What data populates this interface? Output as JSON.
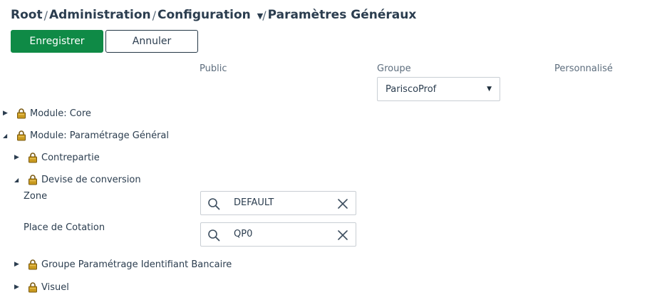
{
  "breadcrumb": {
    "items": [
      "Root",
      "Administration",
      "Configuration"
    ],
    "separator": "/",
    "current": "Paramètres Généraux"
  },
  "toolbar": {
    "save_label": "Enregistrer",
    "cancel_label": "Annuler"
  },
  "columns": {
    "public": "Public",
    "group": "Groupe",
    "custom": "Personnalisé"
  },
  "group_select": {
    "value": "PariscoProf"
  },
  "tree": {
    "module_core": {
      "label": "Module: Core",
      "expanded": false
    },
    "module_param": {
      "label": "Module: Paramétrage Général",
      "expanded": true
    },
    "contrepartie": {
      "label": "Contrepartie",
      "expanded": false
    },
    "devise": {
      "label": "Devise de conversion",
      "expanded": true
    },
    "groupe_iban": {
      "label": "Groupe Paramétrage Identifiant Bancaire",
      "expanded": false
    },
    "visuel": {
      "label": "Visuel",
      "expanded": false
    }
  },
  "fields": {
    "zone": {
      "label": "Zone",
      "value": "DEFAULT"
    },
    "cotation": {
      "label": "Place de Cotation",
      "value": "QP0"
    }
  },
  "colors": {
    "primary_green": "#0f8a46",
    "text_dark": "#2b3d4f",
    "lock_gold": "#c99a1e"
  }
}
